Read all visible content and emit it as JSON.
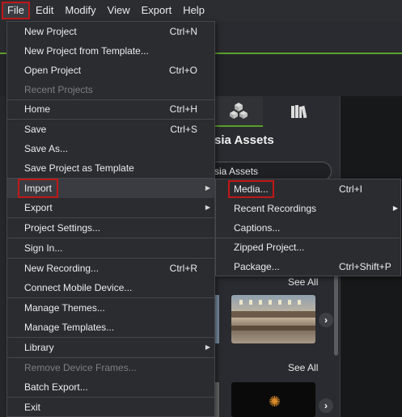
{
  "menubar": {
    "items": [
      "File",
      "Edit",
      "Modify",
      "View",
      "Export",
      "Help"
    ],
    "active": "File"
  },
  "library": {
    "title_fragment": "sia Assets",
    "search_fragment": "sia Assets",
    "see_all_1": "See All",
    "see_all_2": "See All"
  },
  "file_menu": {
    "items": [
      {
        "label": "New Project",
        "shortcut": "Ctrl+N"
      },
      {
        "label": "New Project from Template...",
        "shortcut": ""
      },
      {
        "label": "Open Project",
        "shortcut": "Ctrl+O"
      },
      {
        "label": "Recent Projects",
        "shortcut": "",
        "disabled": true
      },
      {
        "label": "Home",
        "shortcut": "Ctrl+H"
      },
      {
        "label": "Save",
        "shortcut": "Ctrl+S"
      },
      {
        "label": "Save As...",
        "shortcut": ""
      },
      {
        "label": "Save Project as Template",
        "shortcut": ""
      },
      {
        "label": "Import",
        "shortcut": "",
        "submenu": true,
        "highlighted": true
      },
      {
        "label": "Export",
        "shortcut": "",
        "submenu": true
      },
      {
        "label": "Project Settings...",
        "shortcut": ""
      },
      {
        "label": "Sign In...",
        "shortcut": ""
      },
      {
        "label": "New Recording...",
        "shortcut": "Ctrl+R"
      },
      {
        "label": "Connect Mobile Device...",
        "shortcut": ""
      },
      {
        "label": "Manage Themes...",
        "shortcut": ""
      },
      {
        "label": "Manage Templates...",
        "shortcut": ""
      },
      {
        "label": "Library",
        "shortcut": "",
        "submenu": true
      },
      {
        "label": "Remove Device Frames...",
        "shortcut": "",
        "disabled": true
      },
      {
        "label": "Batch Export...",
        "shortcut": ""
      },
      {
        "label": "Exit",
        "shortcut": ""
      }
    ]
  },
  "import_submenu": {
    "items": [
      {
        "label": "Media...",
        "shortcut": "Ctrl+I",
        "highlighted": true
      },
      {
        "label": "Recent Recordings",
        "shortcut": "",
        "submenu": true
      },
      {
        "label": "Captions...",
        "shortcut": ""
      },
      {
        "label": "Zipped Project...",
        "shortcut": ""
      },
      {
        "label": "Package...",
        "shortcut": "Ctrl+Shift+P"
      }
    ]
  },
  "colors": {
    "highlight_outline": "#c01818",
    "accent_green": "#5aa02c",
    "menu_bg": "#2b2c30"
  }
}
